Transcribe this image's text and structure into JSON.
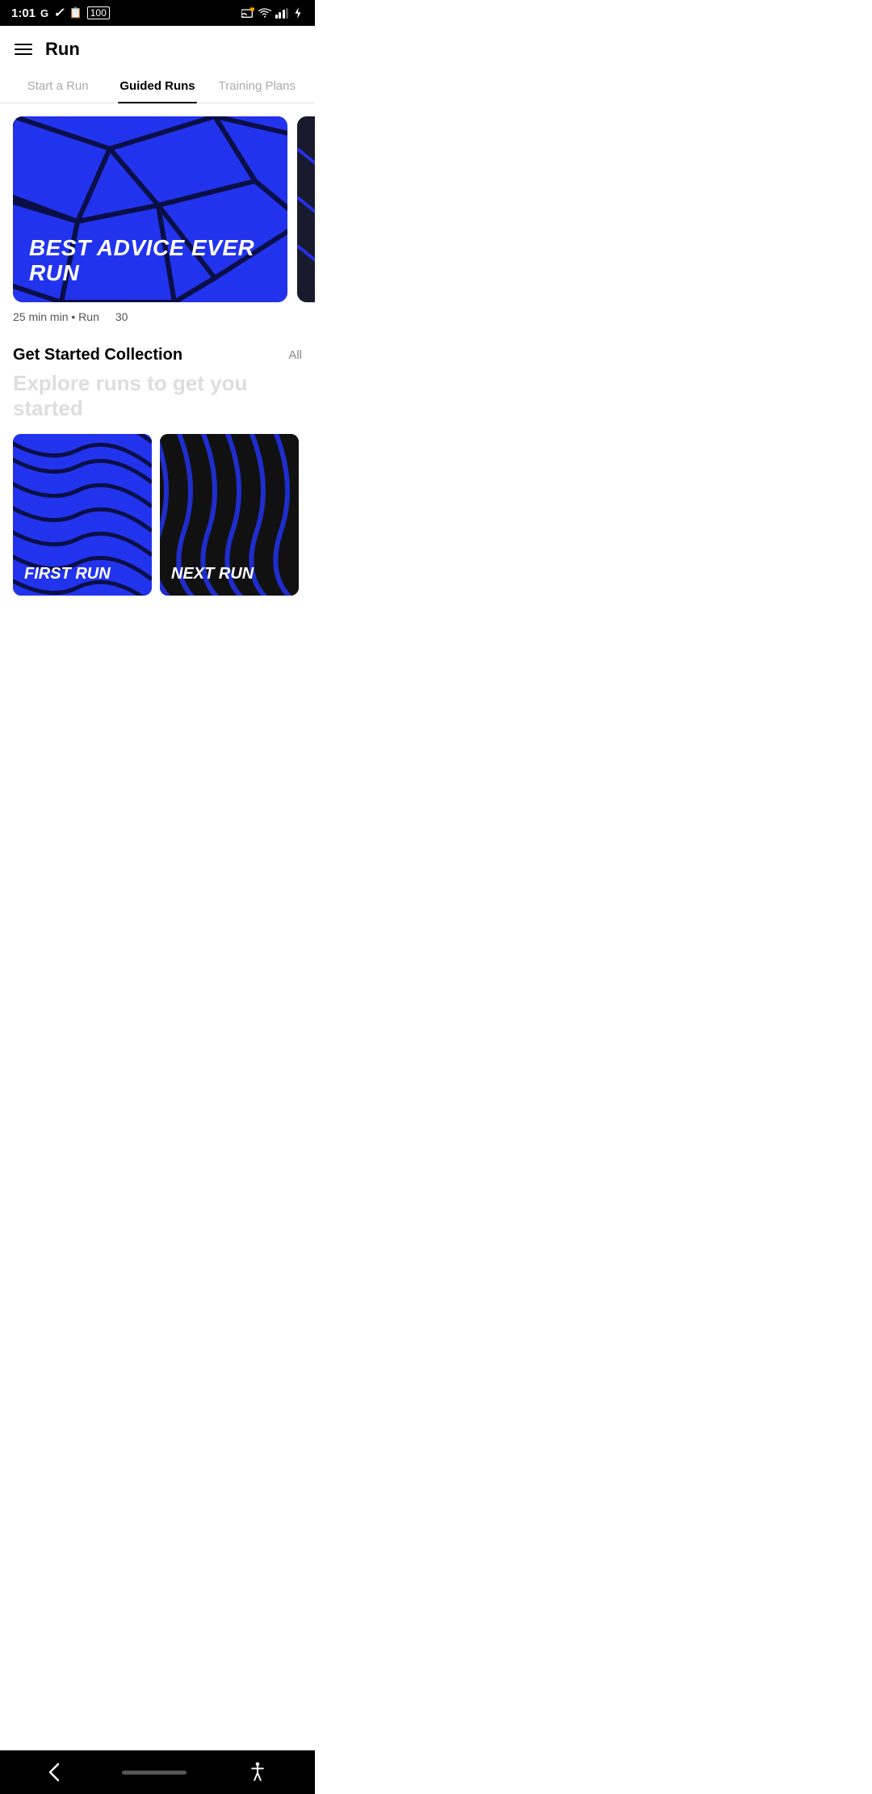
{
  "statusBar": {
    "time": "1:01",
    "leftIcons": [
      "G",
      "nike",
      "clipboard",
      "battery-100"
    ],
    "rightIcons": [
      "cast",
      "wifi",
      "signal",
      "charging"
    ]
  },
  "header": {
    "title": "Run",
    "menuIcon": "hamburger"
  },
  "tabs": [
    {
      "id": "start-run",
      "label": "Start a Run",
      "active": false
    },
    {
      "id": "guided-runs",
      "label": "Guided Runs",
      "active": true
    },
    {
      "id": "training-plans",
      "label": "Training Plans",
      "active": false
    }
  ],
  "featuredCards": [
    {
      "id": "card-1",
      "title": "BEST ADVICE EVER RUN",
      "duration": "25 min",
      "type": "Run",
      "bgColor": "#2233ee"
    },
    {
      "id": "card-2",
      "duration": "30",
      "bgColor": "#1a1a2e"
    }
  ],
  "collection": {
    "title": "Get Started Collection",
    "allLabel": "All",
    "subtitle": "Explore runs to get you started",
    "cards": [
      {
        "id": "first-run",
        "title": "FIRST RUN",
        "bgColor1": "#2233ee",
        "bgColor2": "#000"
      },
      {
        "id": "next-run",
        "title": "NEXT RUN",
        "bgColor1": "#000",
        "bgColor2": "#2233ee"
      }
    ]
  },
  "bottomNav": {
    "backLabel": "‹",
    "homeIndicatorLabel": "home",
    "accessibilityLabel": "accessibility"
  }
}
